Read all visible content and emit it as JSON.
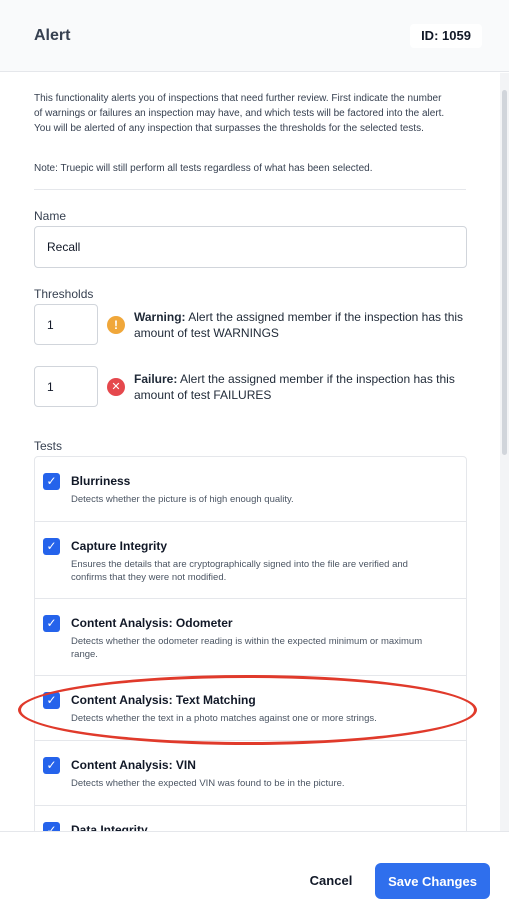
{
  "header": {
    "title": "Alert",
    "id_label": "ID: 1059"
  },
  "intro": {
    "text": "This functionality alerts you of inspections that need further review. First indicate the number of warnings or failures an inspection may have, and which tests will be factored into the alert. You will be alerted of any inspection that surpasses the thresholds for the selected tests.",
    "note": "Note: Truepic will still perform all tests regardless of what has been selected."
  },
  "name": {
    "label": "Name",
    "value": "Recall"
  },
  "thresholds": {
    "label": "Thresholds",
    "warning": {
      "value": "1",
      "title": "Warning:",
      "text": " Alert the assigned member if the inspection has this amount of test WARNINGS",
      "icon": "warning-icon",
      "color": "#f0a73a"
    },
    "failure": {
      "value": "1",
      "title": "Failure:",
      "text": " Alert the assigned member if the inspection has this amount of test FAILURES",
      "icon": "error-icon",
      "color": "#e5484d"
    }
  },
  "tests": {
    "label": "Tests",
    "items": [
      {
        "title": "Blurriness",
        "description": "Detects whether the picture is of high enough quality.",
        "checked": true
      },
      {
        "title": "Capture Integrity",
        "description": "Ensures the details that are cryptographically signed into the file are verified and confirms that they were not modified.",
        "checked": true
      },
      {
        "title": "Content Analysis: Odometer",
        "description": "Detects whether the odometer reading is within the expected minimum or maximum range.",
        "checked": true
      },
      {
        "title": "Content Analysis: Text Matching",
        "description": "Detects whether the text in a photo matches against one or more strings.",
        "checked": true
      },
      {
        "title": "Content Analysis: VIN",
        "description": "Detects whether the expected VIN was found to be in the picture.",
        "checked": true
      },
      {
        "title": "Data Integrity",
        "description": "",
        "checked": true
      }
    ]
  },
  "footer": {
    "cancel_label": "Cancel",
    "save_label": "Save Changes"
  },
  "colors": {
    "accent": "#2f6fed",
    "highlight": "#e03a2b"
  }
}
